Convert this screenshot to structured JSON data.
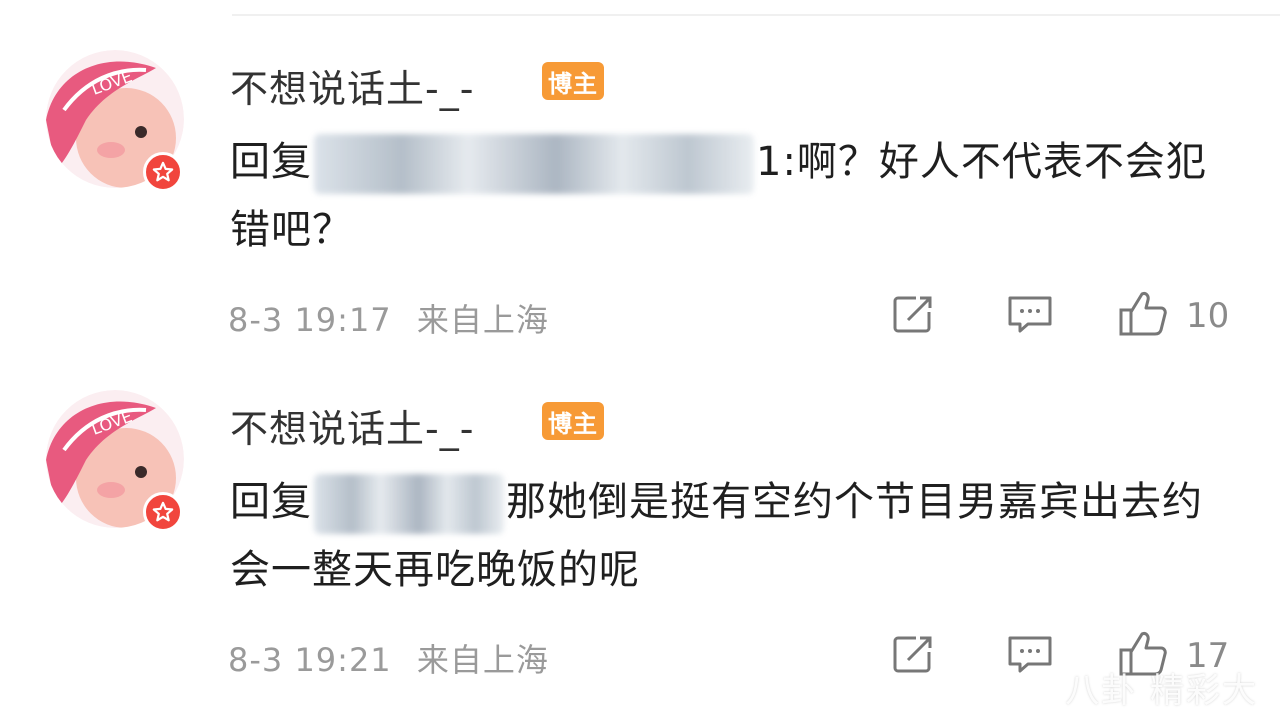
{
  "comments": [
    {
      "username": "不想说话土-_-",
      "tag": "博主",
      "reply_prefix": "回复",
      "reply_suffix": "1:啊？好人不代表不会犯错吧？",
      "date": "8-3 19:17",
      "location": "来自上海",
      "likes": "10"
    },
    {
      "username": "不想说话土-_-",
      "tag": "博主",
      "reply_prefix": "回复",
      "reply_suffix": "那她倒是挺有空约个节目男嘉宾出去约会一整天再吃晚饭的呢",
      "date": "8-3 19:21",
      "location": "来自上海",
      "likes": "17"
    }
  ],
  "icons": {
    "repost": "repost-icon",
    "comment": "comment-icon",
    "like": "thumbs-up-icon",
    "verified": "star-badge-icon"
  },
  "colors": {
    "tag_bg": "#f79a36",
    "badge_red": "#f1453d",
    "meta_gray": "#9a9a9a"
  },
  "watermark": "八卦 精彩大"
}
